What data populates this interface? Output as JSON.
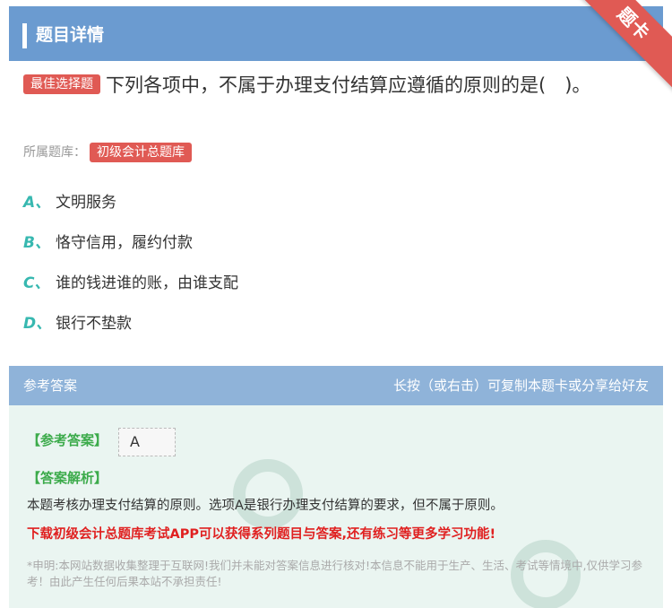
{
  "header": {
    "title": "题目详情",
    "corner_badge": "题卡"
  },
  "question": {
    "type_tag": "最佳选择题",
    "text": "下列各项中，不属于办理支付结算应遵循的原则的是(　)。",
    "source_label": "所属题库：",
    "source_value": "初级会计总题库"
  },
  "options": [
    {
      "letter": "A、",
      "text": "文明服务"
    },
    {
      "letter": "B、",
      "text": "恪守信用，履约付款"
    },
    {
      "letter": "C、",
      "text": "谁的钱进谁的账，由谁支配"
    },
    {
      "letter": "D、",
      "text": "银行不垫款"
    }
  ],
  "answer_bar": {
    "left": "参考答案",
    "right": "长按（或右击）可复制本题卡或分享给好友"
  },
  "answer": {
    "ref_label": "【参考答案】",
    "ref_value": "A",
    "exp_label": "【答案解析】",
    "exp_text": "本题考核办理支付结算的原则。选项A是银行办理支付结算的要求，但不属于原则。",
    "promo": "下载初级会计总题库考试APP可以获得系列题目与答案,还有练习等更多学习功能!",
    "disclaimer": "*申明:本网站数据收集整理于互联网!我们并未能对答案信息进行核对!本信息不能用于生产、生活、考试等情境中,仅供学习参考！由此产生任何后果本站不承担责任!"
  },
  "colors": {
    "header_bg": "#6b9bd0",
    "tag_red": "#e05a54",
    "option_letter": "#37b8b0",
    "answer_green": "#3cab4b",
    "promo_red": "#e02020"
  }
}
